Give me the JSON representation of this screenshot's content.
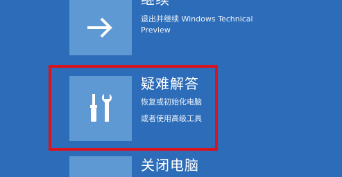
{
  "options": [
    {
      "title": "继续",
      "description": "退出并继续 Windows Technical Preview",
      "icon": "arrow-right-icon"
    },
    {
      "title": "疑难解答",
      "description_line1": "恢复或初始化电脑",
      "description_line2": "或者使用高级工具",
      "icon": "tools-icon"
    },
    {
      "title": "关闭电脑",
      "icon": "power-icon"
    }
  ],
  "colors": {
    "background": "#2c6cb8",
    "tile": "#5e99d3",
    "highlight": "#d8141e"
  }
}
